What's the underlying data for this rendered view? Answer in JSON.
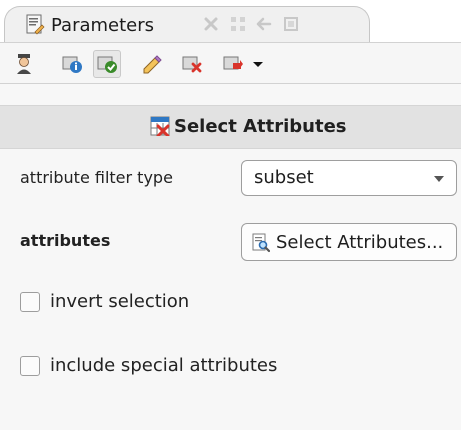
{
  "panel": {
    "title": "Parameters",
    "icons": {
      "tab": "parameters-icon",
      "close": "close-icon",
      "detach": "detach-icon",
      "restore": "restore-icon",
      "maximize": "maximize-icon"
    }
  },
  "toolbar": {
    "items": [
      {
        "name": "expert-mode-icon"
      },
      {
        "name": "info-icon"
      },
      {
        "name": "apply-icon"
      },
      {
        "name": "edit-icon"
      },
      {
        "name": "delete-icon"
      },
      {
        "name": "dropdown-icon"
      }
    ]
  },
  "section": {
    "title": "Select Attributes",
    "icon": "select-attributes-icon"
  },
  "params": {
    "filter_type_label": "attribute filter type",
    "filter_type_value": "subset",
    "attributes_label": "attributes",
    "attributes_button": "Select Attributes...",
    "invert_label": "invert selection",
    "special_label": "include special attributes"
  },
  "colors": {
    "background": "#f7f7f7",
    "header": "#e2e2e2",
    "border": "#9e9e9e",
    "accent_red": "#d9342b",
    "accent_blue": "#2f78c4",
    "accent_green": "#3a8b2a"
  }
}
